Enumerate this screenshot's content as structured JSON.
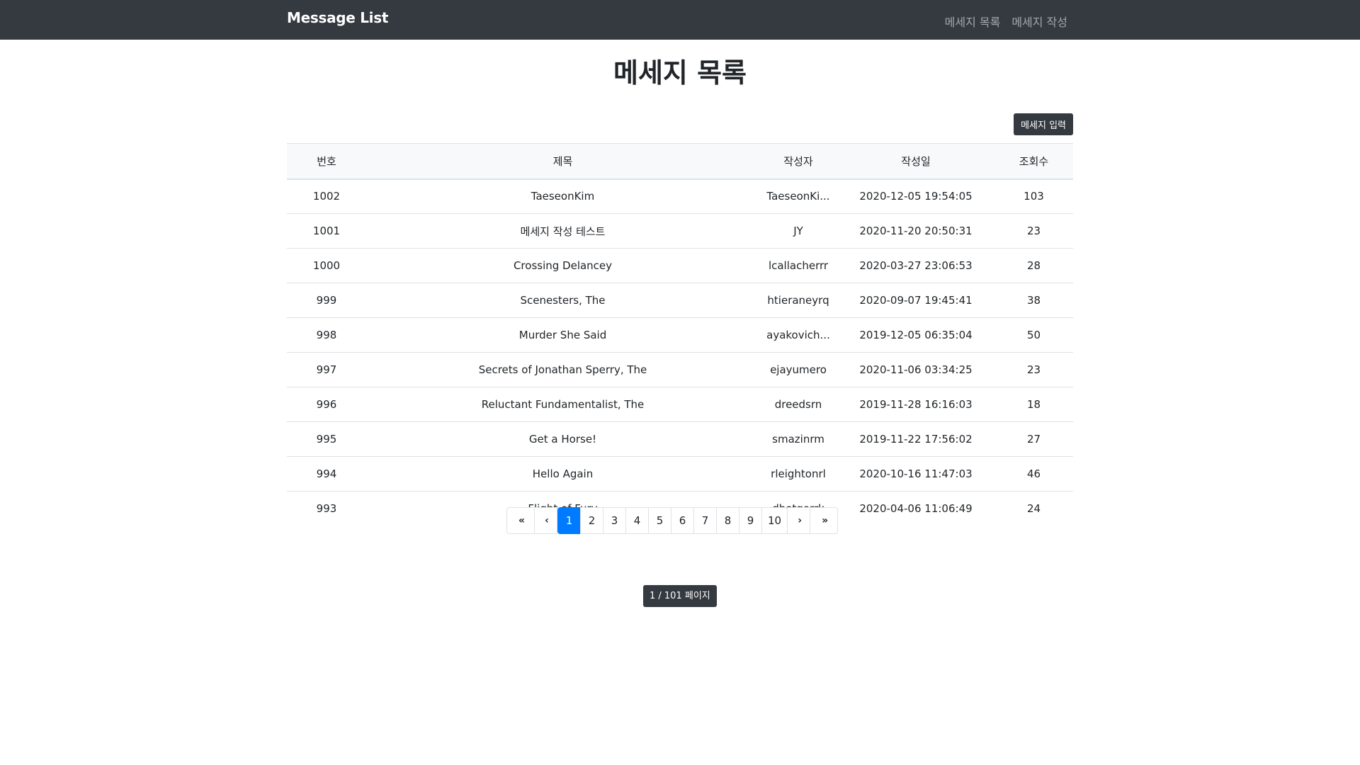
{
  "navbar": {
    "brand": "Message List",
    "links": [
      "메세지 목록",
      "메세지 작성"
    ]
  },
  "main": {
    "title": "메세지 목록",
    "new_button": "메세지 입력"
  },
  "table": {
    "headers": [
      "번호",
      "제목",
      "작성자",
      "작성일",
      "조회수"
    ],
    "rows": [
      {
        "no": "1002",
        "title": "TaeseonKim",
        "writer": "TaeseonKi...",
        "date": "2020-12-05 19:54:05",
        "views": "103"
      },
      {
        "no": "1001",
        "title": "메세지 작성 테스트",
        "writer": "JY",
        "date": "2020-11-20 20:50:31",
        "views": "23"
      },
      {
        "no": "1000",
        "title": "Crossing Delancey",
        "writer": "lcallacherrr",
        "date": "2020-03-27 23:06:53",
        "views": "28"
      },
      {
        "no": "999",
        "title": "Scenesters, The",
        "writer": "htieraneyrq",
        "date": "2020-09-07 19:45:41",
        "views": "38"
      },
      {
        "no": "998",
        "title": "Murder She Said",
        "writer": "ayakovich...",
        "date": "2019-12-05 06:35:04",
        "views": "50"
      },
      {
        "no": "997",
        "title": "Secrets of Jonathan Sperry, The",
        "writer": "ejayumero",
        "date": "2020-11-06 03:34:25",
        "views": "23"
      },
      {
        "no": "996",
        "title": "Reluctant Fundamentalist, The",
        "writer": "dreedsrn",
        "date": "2019-11-28 16:16:03",
        "views": "18"
      },
      {
        "no": "995",
        "title": "Get a Horse!",
        "writer": "smazinrm",
        "date": "2019-11-22 17:56:02",
        "views": "27"
      },
      {
        "no": "994",
        "title": "Hello Again",
        "writer": "rleightonrl",
        "date": "2020-10-16 11:47:03",
        "views": "46"
      },
      {
        "no": "993",
        "title": "Flight of Fury",
        "writer": "dbotgerrk",
        "date": "2020-04-06 11:06:49",
        "views": "24"
      }
    ]
  },
  "pagination": {
    "first": "«",
    "prev": "‹",
    "pages": [
      "1",
      "2",
      "3",
      "4",
      "5",
      "6",
      "7",
      "8",
      "9",
      "10"
    ],
    "active_page": "1",
    "next": "›",
    "last": "»",
    "info": "1 / 101 페이지"
  },
  "colors": {
    "navbar": "#343a40",
    "active_page": "#007bff",
    "header_bg": "#f8f9fa"
  }
}
